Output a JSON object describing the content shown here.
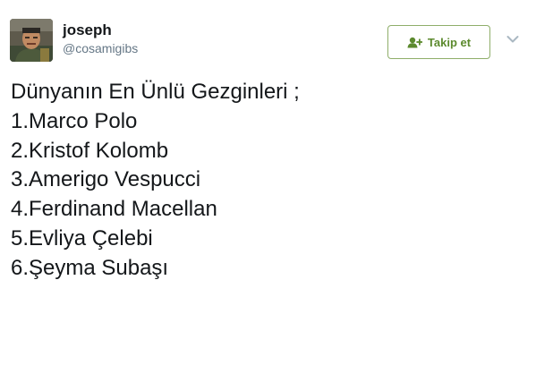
{
  "user": {
    "display_name": "joseph",
    "screen_name": "@cosamigibs",
    "avatar_icon": "user-avatar-photo"
  },
  "follow_button": {
    "label": "Takip et",
    "icon": "add-user-icon"
  },
  "menu": {
    "icon": "chevron-down-icon"
  },
  "tweet": {
    "lines": [
      "Dünyanın En Ünlü Gezginleri ;",
      "1.Marco Polo",
      "2.Kristof Kolomb",
      "3.Amerigo Vespucci",
      "4.Ferdinand Macellan",
      "5.Evliya Çelebi",
      "6.Şeyma Subaşı"
    ]
  },
  "colors": {
    "text": "#14171a",
    "secondary_text": "#657786",
    "follow_accent": "#5c8a2e",
    "follow_border": "#8fae6a",
    "caret": "#aab8c2"
  }
}
